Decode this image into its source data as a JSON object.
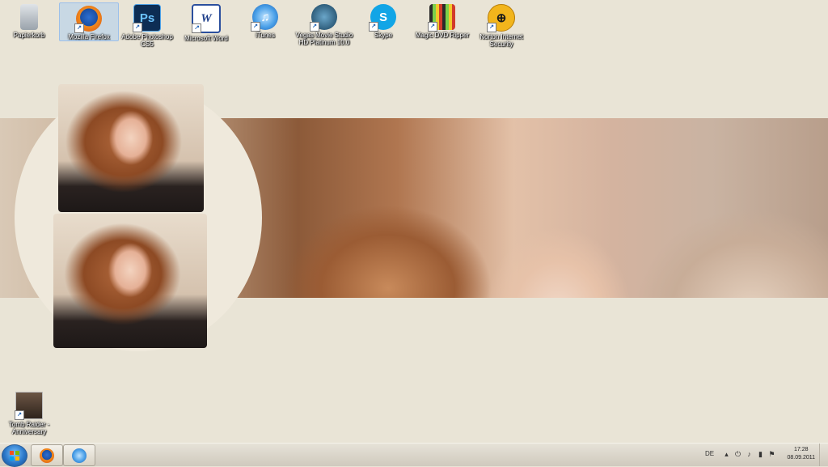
{
  "desktop": {
    "icons": [
      {
        "label": "Papierkorb",
        "icon": "recycle-bin-icon"
      },
      {
        "label": "Mozilla Firefox",
        "icon": "firefox-icon"
      },
      {
        "label": "Adobe Photoshop CS5",
        "icon": "photoshop-icon",
        "glyph": "Ps"
      },
      {
        "label": "Microsoft Word",
        "icon": "word-icon",
        "glyph": "W"
      },
      {
        "label": "iTunes",
        "icon": "itunes-icon",
        "glyph": "♫"
      },
      {
        "label": "Vegas Movie Studio HD Platinum 10.0",
        "icon": "vegas-icon"
      },
      {
        "label": "Skype",
        "icon": "skype-icon",
        "glyph": "S"
      },
      {
        "label": "Magic DVD Ripper",
        "icon": "dvd-ripper-icon"
      },
      {
        "label": "Norton Internet Security",
        "icon": "norton-icon",
        "glyph": "⊕"
      },
      {
        "label": "Tomb Raider - Anniversary",
        "icon": "tomb-raider-icon"
      }
    ]
  },
  "taskbar": {
    "pinned": [
      {
        "name": "firefox",
        "icon": "firefox-icon"
      },
      {
        "name": "itunes",
        "icon": "itunes-icon"
      }
    ],
    "tray": {
      "language": "DE",
      "time": "17:28",
      "date": "08.09.2011"
    }
  },
  "colors": {
    "desktop_bg": "#e9e4d6",
    "selection": "#add0f0",
    "taskbar": "#d6d0c2"
  }
}
